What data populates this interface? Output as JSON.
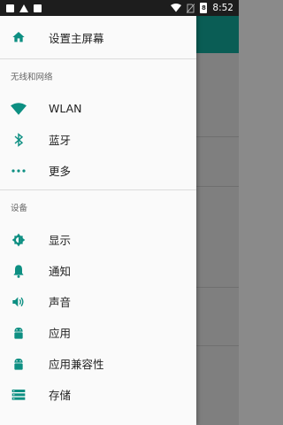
{
  "status_bar": {
    "time": "8:52",
    "battery_text": "8",
    "icons": [
      "notification-square-icon",
      "warning-icon",
      "notification-square-icon",
      "wifi-icon",
      "no-sim-icon",
      "battery-icon"
    ]
  },
  "drawer": {
    "home": {
      "label": "设置主屏幕",
      "icon": "home-icon"
    },
    "sections": [
      {
        "title": "无线和网络",
        "items": [
          {
            "label": "WLAN",
            "icon": "wifi-icon"
          },
          {
            "label": "蓝牙",
            "icon": "bluetooth-icon"
          },
          {
            "label": "更多",
            "icon": "more-dots-icon"
          }
        ]
      },
      {
        "title": "设备",
        "items": [
          {
            "label": "显示",
            "icon": "brightness-icon"
          },
          {
            "label": "通知",
            "icon": "bell-icon"
          },
          {
            "label": "声音",
            "icon": "volume-icon"
          },
          {
            "label": "应用",
            "icon": "android-icon"
          },
          {
            "label": "应用兼容性",
            "icon": "android-icon"
          },
          {
            "label": "存储",
            "icon": "storage-icon"
          }
        ]
      }
    ]
  },
  "colors": {
    "accent": "#0d8f82",
    "toolbar": "#0a5d55"
  }
}
